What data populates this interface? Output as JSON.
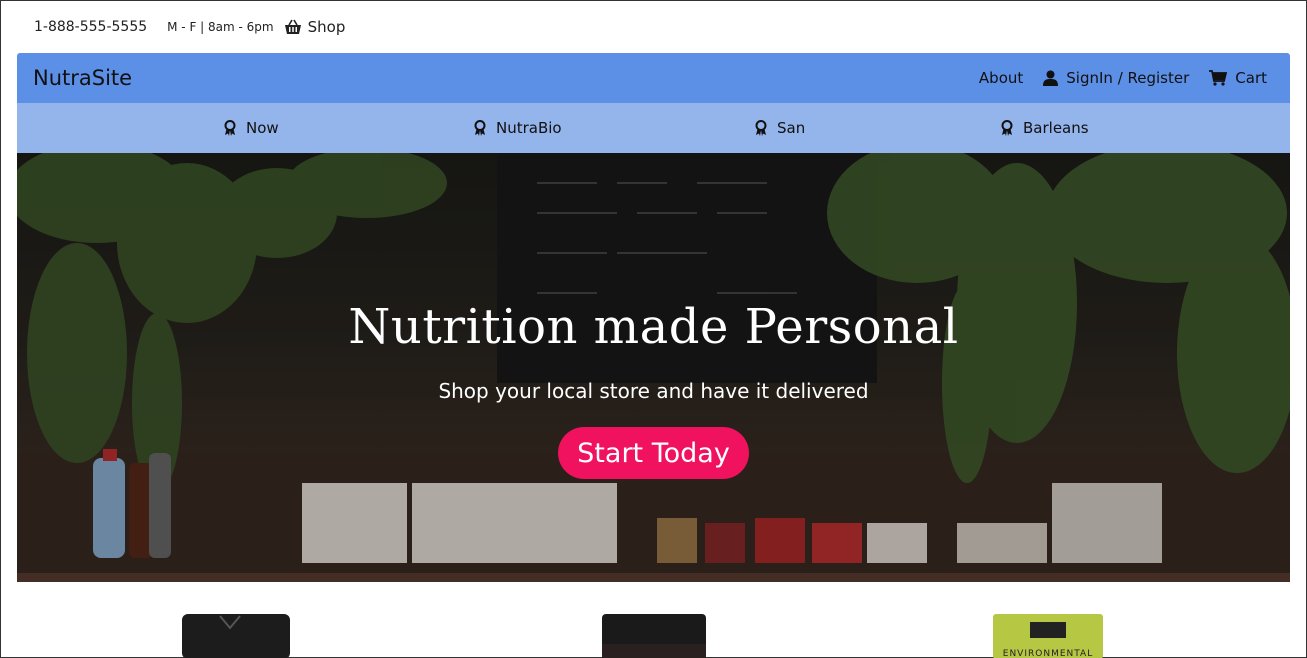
{
  "topbar": {
    "phone": "1-888-555-5555",
    "hours": "M - F | 8am - 6pm",
    "shop_label": "Shop",
    "shop_icon": "basket-icon"
  },
  "navbar": {
    "brand": "NutraSite",
    "about_label": "About",
    "signin_label": "SignIn / Register",
    "signin_icon": "user-icon",
    "cart_label": "Cart",
    "cart_icon": "cart-icon",
    "color": "#5c8fe6"
  },
  "brandbar": {
    "color": "#94b4ec",
    "items": [
      {
        "label": "Now",
        "icon": "award-icon"
      },
      {
        "label": "NutraBio",
        "icon": "award-icon"
      },
      {
        "label": "San",
        "icon": "award-icon"
      },
      {
        "label": "Barleans",
        "icon": "award-icon"
      }
    ]
  },
  "hero": {
    "title": "Nutrition made Personal",
    "subtitle": "Shop your local store and have it delivered",
    "cta_label": "Start Today",
    "cta_color": "#f0115f"
  },
  "products": [
    {
      "name": "product-black-jar"
    },
    {
      "name": "product-dark-tub"
    },
    {
      "name": "product-green-box",
      "label": "ENVIRONMENTAL"
    }
  ]
}
